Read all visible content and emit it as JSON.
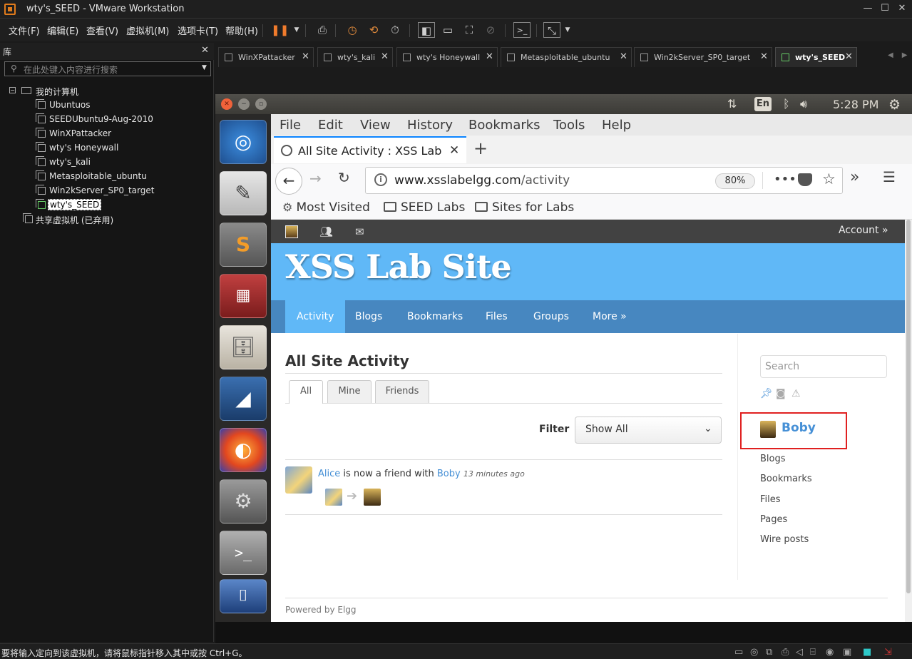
{
  "window": {
    "title": "wty's_SEED - VMware Workstation"
  },
  "menu": [
    "文件(F)",
    "编辑(E)",
    "查看(V)",
    "虚拟机(M)",
    "选项卡(T)",
    "帮助(H)"
  ],
  "library": {
    "title": "库",
    "search_placeholder": "在此处键入内容进行搜索",
    "root": "我的计算机",
    "vms": [
      "Ubuntuos",
      "SEEDUbuntu9-Aug-2010",
      "WinXPattacker",
      "wty's Honeywall",
      "wty's_kali",
      "Metasploitable_ubuntu",
      "Win2kServer_SP0_target",
      "wty's_SEED"
    ],
    "shared": "共享虚拟机 (已弃用)"
  },
  "vm_tabs": [
    {
      "label": "WinXPattacker",
      "active": false
    },
    {
      "label": "wty's_kali",
      "active": false
    },
    {
      "label": "wty's Honeywall",
      "active": false
    },
    {
      "label": "Metasploitable_ubuntu",
      "active": false
    },
    {
      "label": "Win2kServer_SP0_target",
      "active": false
    },
    {
      "label": "wty's_SEED",
      "active": true
    }
  ],
  "ubuntu": {
    "lang": "En",
    "clock": "5:28 PM"
  },
  "firefox": {
    "menu": [
      "File",
      "Edit",
      "View",
      "History",
      "Bookmarks",
      "Tools",
      "Help"
    ],
    "tab_title": "All Site Activity : XSS Lab Site",
    "url_host": "www.xsslabelgg.com",
    "url_path": "/activity",
    "zoom": "80%",
    "bookmarks": [
      "Most Visited",
      "SEED Labs",
      "Sites for Labs"
    ]
  },
  "elgg": {
    "account": "Account »",
    "site_name": "XSS Lab Site",
    "nav": [
      "Activity",
      "Blogs",
      "Bookmarks",
      "Files",
      "Groups",
      "More »"
    ],
    "nav_active": "Activity",
    "page_title": "All Site Activity",
    "tabs": [
      "All",
      "Mine",
      "Friends"
    ],
    "filter_label": "Filter",
    "filter_value": "Show All",
    "activity": {
      "subject": "Alice",
      "verb": "is now a friend with",
      "object": "Boby",
      "time": "13 minutes ago"
    },
    "search_placeholder": "Search",
    "owner_name": "Boby",
    "owner_links": [
      "Blogs",
      "Bookmarks",
      "Files",
      "Pages",
      "Wire posts"
    ],
    "footer": "Powered by Elgg"
  },
  "status": {
    "text": "要将输入定向到该虚拟机，请将鼠标指针移入其中或按 Ctrl+G。"
  },
  "colors": {
    "elgg_header": "#60b8f7",
    "elgg_nav": "#4787c0",
    "highlight_box": "#e02020",
    "vmware_accent": "#e07b1c"
  }
}
